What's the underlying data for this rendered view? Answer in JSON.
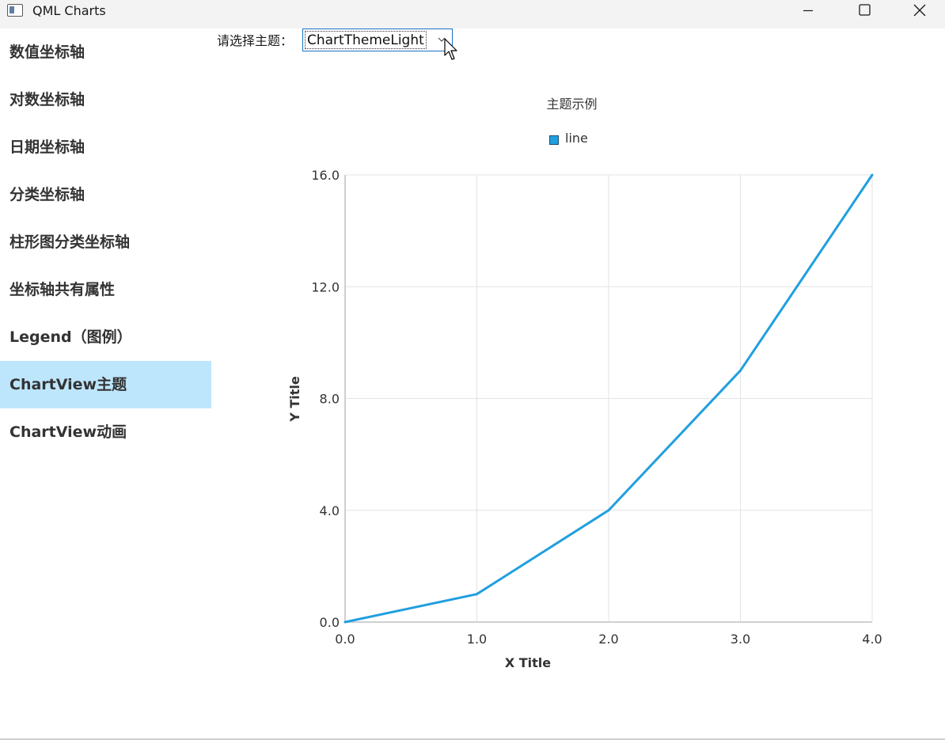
{
  "window": {
    "title": "QML Charts",
    "icon": "app-window-icon",
    "controls": [
      "minimize-icon",
      "maximize-icon",
      "close-icon"
    ]
  },
  "sidebar": {
    "items": [
      {
        "label": "数值坐标轴",
        "active": false
      },
      {
        "label": "对数坐标轴",
        "active": false
      },
      {
        "label": "日期坐标轴",
        "active": false
      },
      {
        "label": "分类坐标轴",
        "active": false
      },
      {
        "label": "柱形图分类坐标轴",
        "active": false
      },
      {
        "label": "坐标轴共有属性",
        "active": false
      },
      {
        "label": "Legend（图例）",
        "active": false
      },
      {
        "label": "ChartView主题",
        "active": true
      },
      {
        "label": "ChartView动画",
        "active": false
      }
    ],
    "active_color": "#bde6fd"
  },
  "theme_selector": {
    "label": "请选择主题：",
    "selected": "ChartThemeLight"
  },
  "chart_data": {
    "type": "line",
    "title": "主题示例",
    "xlabel": "X Title",
    "ylabel": "Y Title",
    "xlim": [
      0,
      4
    ],
    "ylim": [
      0,
      16
    ],
    "x_ticks": [
      "0.0",
      "1.0",
      "2.0",
      "3.0",
      "4.0"
    ],
    "y_ticks": [
      "0.0",
      "4.0",
      "8.0",
      "12.0",
      "16.0"
    ],
    "grid": true,
    "legend_position": "top",
    "series": [
      {
        "name": "line",
        "color": "#209fdf",
        "x": [
          0,
          1,
          2,
          3,
          4
        ],
        "y": [
          0,
          1,
          4,
          9,
          16
        ]
      }
    ]
  }
}
